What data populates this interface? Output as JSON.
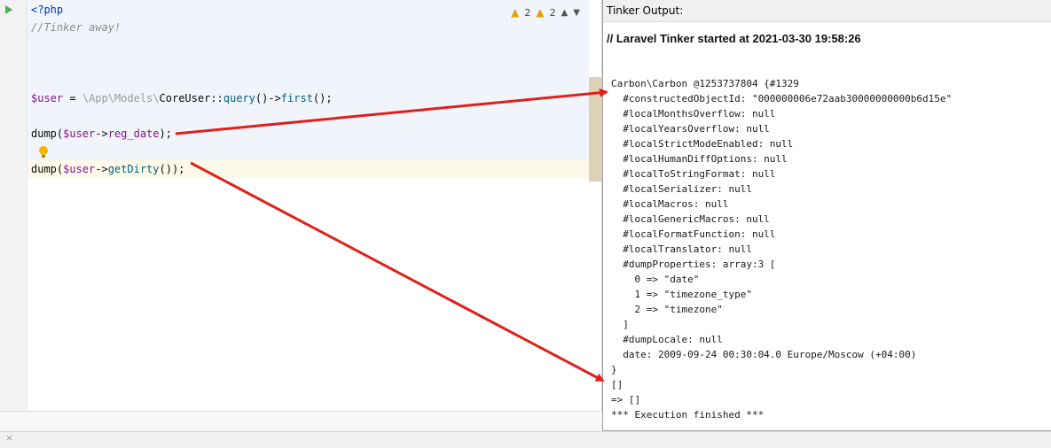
{
  "editor": {
    "inspections": {
      "warnings_a": "2",
      "warnings_b": "2"
    },
    "lines": {
      "php_open": "<?php",
      "comment": "//Tinker away!",
      "line3": {
        "var": "$user",
        "assign": " = ",
        "ns1": "\\App\\Models\\",
        "cls": "CoreUser",
        "op": "::",
        "m1": "query",
        "mid": "()->",
        "m2": "first",
        "end": "();"
      },
      "line4": {
        "fn": "dump(",
        "var": "$user",
        "arrow": "->",
        "prop": "reg_date",
        "end": ");"
      },
      "line5": {
        "fn": "dump(",
        "var": "$user",
        "arrow": "->",
        "m": "getDirty",
        "end": "());"
      }
    }
  },
  "output": {
    "title": "Tinker Output:",
    "header": "// Laravel Tinker started at 2021-03-30 19:58:26",
    "lines": [
      "Carbon\\Carbon @1253737804 {#1329",
      "  #constructedObjectId: \"000000006e72aab30000000000b6d15e\"",
      "  #localMonthsOverflow: null",
      "  #localYearsOverflow: null",
      "  #localStrictModeEnabled: null",
      "  #localHumanDiffOptions: null",
      "  #localToStringFormat: null",
      "  #localSerializer: null",
      "  #localMacros: null",
      "  #localGenericMacros: null",
      "  #localFormatFunction: null",
      "  #localTranslator: null",
      "  #dumpProperties: array:3 [",
      "    0 => \"date\"",
      "    1 => \"timezone_type\"",
      "    2 => \"timezone\"",
      "  ]",
      "  #dumpLocale: null",
      "  date: 2009-09-24 00:30:04.0 Europe/Moscow (+04:00)",
      "}",
      "[]",
      "=> []",
      "*** Execution finished ***"
    ]
  },
  "bottom": {
    "close_glyph": "×"
  },
  "colors": {
    "arrow": "#e0201b",
    "run": "#4caf50"
  }
}
